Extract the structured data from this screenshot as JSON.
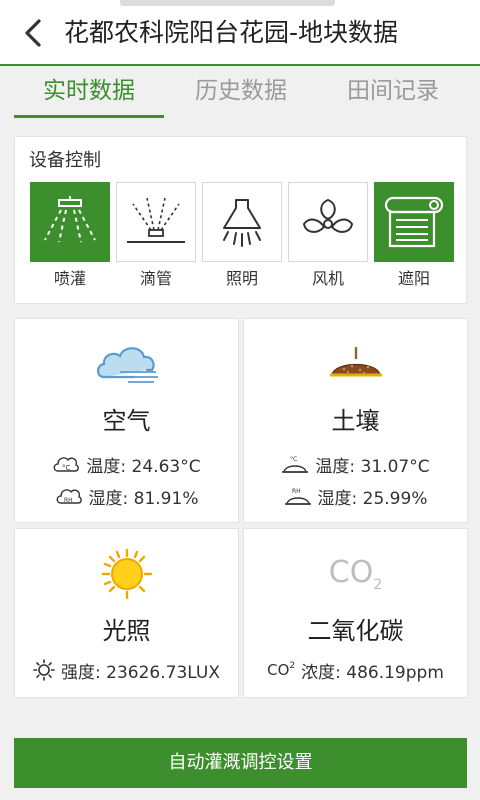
{
  "header": {
    "title": "花都农科院阳台花园-地块数据"
  },
  "tabs": [
    {
      "label": "实时数据",
      "active": true
    },
    {
      "label": "历史数据",
      "active": false
    },
    {
      "label": "田间记录",
      "active": false
    }
  ],
  "device_control": {
    "title": "设备控制",
    "devices": [
      {
        "label": "喷灌",
        "icon": "sprinkler-icon",
        "on": true
      },
      {
        "label": "滴管",
        "icon": "drip-icon",
        "on": false
      },
      {
        "label": "照明",
        "icon": "lamp-icon",
        "on": false
      },
      {
        "label": "风机",
        "icon": "fan-icon",
        "on": false
      },
      {
        "label": "遮阳",
        "icon": "shade-icon",
        "on": true
      }
    ]
  },
  "sensors": {
    "air": {
      "name": "空气",
      "temp": "温度: 24.63°C",
      "humidity": "湿度: 81.91%"
    },
    "soil": {
      "name": "土壤",
      "temp": "温度: 31.07°C",
      "humidity": "湿度: 25.99%"
    },
    "light": {
      "name": "光照",
      "intensity": "强度: 23626.73LUX"
    },
    "co2": {
      "name": "二氧化碳",
      "icon_text": "CO",
      "icon_sub": "2",
      "concentration": "浓度: 486.19ppm"
    }
  },
  "bottom_button": {
    "label": "自动灌溉调控设置"
  },
  "colors": {
    "accent": "#3d8f2e",
    "inactive_text": "#9a9a9a"
  }
}
